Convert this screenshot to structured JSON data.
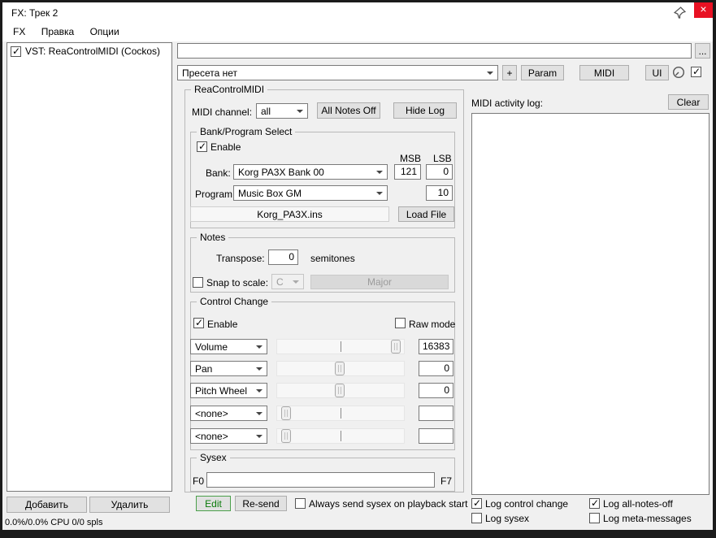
{
  "window": {
    "title": "FX: Трек 2",
    "close_glyph": "×"
  },
  "menu": {
    "items": [
      {
        "label": "FX"
      },
      {
        "label": "Правка"
      },
      {
        "label": "Опции"
      }
    ]
  },
  "fx_chain": {
    "items": [
      {
        "label": "VST: ReaControlMIDI (Cockos)",
        "enabled": true
      }
    ],
    "add_button": "Добавить",
    "remove_button": "Удалить",
    "status": "0.0%/0.0% CPU 0/0 spls"
  },
  "fx_header": {
    "comment_value": "",
    "more_button": "...",
    "preset_value": "Пресета нет",
    "plus_button": "+",
    "param_button": "Param",
    "midi_button": "MIDI",
    "ui_button": "UI",
    "wet_checked": true
  },
  "plugin": {
    "group_title": "ReaControlMIDI",
    "midi_channel_label": "MIDI channel:",
    "midi_channel_value": "all",
    "all_notes_off_button": "All Notes Off",
    "hide_log_button": "Hide Log",
    "bank_program": {
      "title": "Bank/Program Select",
      "enable_label": "Enable",
      "enable_checked": true,
      "msb_label": "MSB",
      "lsb_label": "LSB",
      "bank_label": "Bank:",
      "bank_value": "Korg PA3X Bank 00",
      "bank_msb": "121",
      "bank_lsb": "0",
      "program_label": "Program:",
      "program_value": "Music Box GM",
      "program_number": "10",
      "ins_file": "Korg_PA3X.ins",
      "load_file_button": "Load File"
    },
    "notes": {
      "title": "Notes",
      "transpose_label": "Transpose:",
      "transpose_value": "0",
      "semitones_label": "semitones",
      "snap_label": "Snap to scale:",
      "snap_checked": false,
      "scale_root": "C",
      "scale_type": "Major"
    },
    "control_change": {
      "title": "Control Change",
      "enable_label": "Enable",
      "enable_checked": true,
      "raw_mode_label": "Raw mode",
      "raw_mode_checked": false,
      "rows": [
        {
          "cc": "Volume",
          "value": "16383",
          "pos": 0.97
        },
        {
          "cc": "Pan",
          "value": "0",
          "pos": 0.49
        },
        {
          "cc": "Pitch Wheel",
          "value": "0",
          "pos": 0.49
        },
        {
          "cc": "<none>",
          "value": "",
          "pos": 0.03
        },
        {
          "cc": "<none>",
          "value": "",
          "pos": 0.03
        }
      ]
    },
    "sysex": {
      "title": "Sysex",
      "f0_label": "F0",
      "f7_label": "F7",
      "value": "",
      "edit_button": "Edit",
      "resend_button": "Re-send",
      "always_label": "Always send sysex on playback start",
      "always_checked": false
    }
  },
  "log_panel": {
    "title": "MIDI activity log:",
    "clear_button": "Clear",
    "checks": [
      {
        "label": "Log control change",
        "checked": true
      },
      {
        "label": "Log all-notes-off",
        "checked": true
      },
      {
        "label": "Log sysex",
        "checked": false
      },
      {
        "label": "Log meta-messages",
        "checked": false
      }
    ]
  }
}
